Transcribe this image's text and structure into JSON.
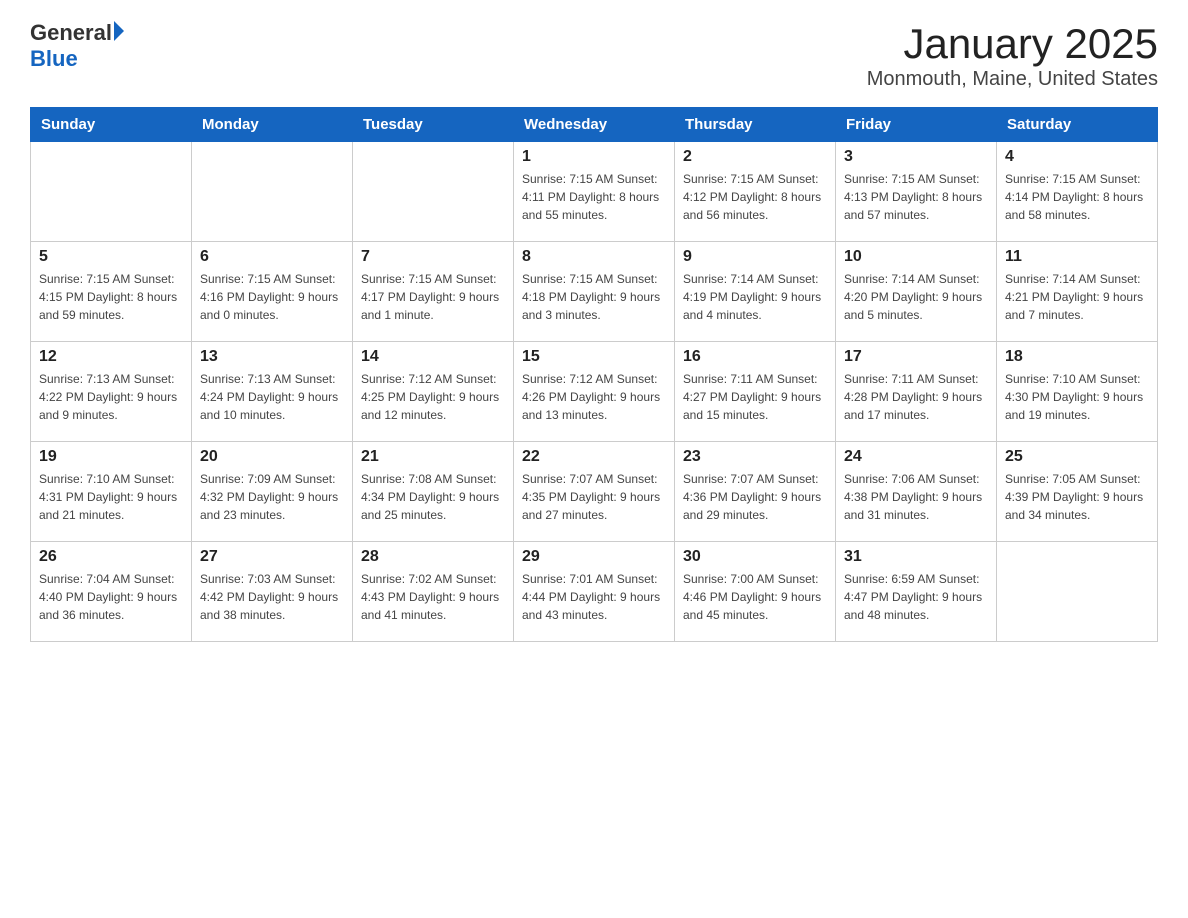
{
  "header": {
    "logo_general": "General",
    "logo_blue": "Blue",
    "title": "January 2025",
    "subtitle": "Monmouth, Maine, United States"
  },
  "days_of_week": [
    "Sunday",
    "Monday",
    "Tuesday",
    "Wednesday",
    "Thursday",
    "Friday",
    "Saturday"
  ],
  "weeks": [
    [
      {
        "day": "",
        "info": ""
      },
      {
        "day": "",
        "info": ""
      },
      {
        "day": "",
        "info": ""
      },
      {
        "day": "1",
        "info": "Sunrise: 7:15 AM\nSunset: 4:11 PM\nDaylight: 8 hours\nand 55 minutes."
      },
      {
        "day": "2",
        "info": "Sunrise: 7:15 AM\nSunset: 4:12 PM\nDaylight: 8 hours\nand 56 minutes."
      },
      {
        "day": "3",
        "info": "Sunrise: 7:15 AM\nSunset: 4:13 PM\nDaylight: 8 hours\nand 57 minutes."
      },
      {
        "day": "4",
        "info": "Sunrise: 7:15 AM\nSunset: 4:14 PM\nDaylight: 8 hours\nand 58 minutes."
      }
    ],
    [
      {
        "day": "5",
        "info": "Sunrise: 7:15 AM\nSunset: 4:15 PM\nDaylight: 8 hours\nand 59 minutes."
      },
      {
        "day": "6",
        "info": "Sunrise: 7:15 AM\nSunset: 4:16 PM\nDaylight: 9 hours\nand 0 minutes."
      },
      {
        "day": "7",
        "info": "Sunrise: 7:15 AM\nSunset: 4:17 PM\nDaylight: 9 hours\nand 1 minute."
      },
      {
        "day": "8",
        "info": "Sunrise: 7:15 AM\nSunset: 4:18 PM\nDaylight: 9 hours\nand 3 minutes."
      },
      {
        "day": "9",
        "info": "Sunrise: 7:14 AM\nSunset: 4:19 PM\nDaylight: 9 hours\nand 4 minutes."
      },
      {
        "day": "10",
        "info": "Sunrise: 7:14 AM\nSunset: 4:20 PM\nDaylight: 9 hours\nand 5 minutes."
      },
      {
        "day": "11",
        "info": "Sunrise: 7:14 AM\nSunset: 4:21 PM\nDaylight: 9 hours\nand 7 minutes."
      }
    ],
    [
      {
        "day": "12",
        "info": "Sunrise: 7:13 AM\nSunset: 4:22 PM\nDaylight: 9 hours\nand 9 minutes."
      },
      {
        "day": "13",
        "info": "Sunrise: 7:13 AM\nSunset: 4:24 PM\nDaylight: 9 hours\nand 10 minutes."
      },
      {
        "day": "14",
        "info": "Sunrise: 7:12 AM\nSunset: 4:25 PM\nDaylight: 9 hours\nand 12 minutes."
      },
      {
        "day": "15",
        "info": "Sunrise: 7:12 AM\nSunset: 4:26 PM\nDaylight: 9 hours\nand 13 minutes."
      },
      {
        "day": "16",
        "info": "Sunrise: 7:11 AM\nSunset: 4:27 PM\nDaylight: 9 hours\nand 15 minutes."
      },
      {
        "day": "17",
        "info": "Sunrise: 7:11 AM\nSunset: 4:28 PM\nDaylight: 9 hours\nand 17 minutes."
      },
      {
        "day": "18",
        "info": "Sunrise: 7:10 AM\nSunset: 4:30 PM\nDaylight: 9 hours\nand 19 minutes."
      }
    ],
    [
      {
        "day": "19",
        "info": "Sunrise: 7:10 AM\nSunset: 4:31 PM\nDaylight: 9 hours\nand 21 minutes."
      },
      {
        "day": "20",
        "info": "Sunrise: 7:09 AM\nSunset: 4:32 PM\nDaylight: 9 hours\nand 23 minutes."
      },
      {
        "day": "21",
        "info": "Sunrise: 7:08 AM\nSunset: 4:34 PM\nDaylight: 9 hours\nand 25 minutes."
      },
      {
        "day": "22",
        "info": "Sunrise: 7:07 AM\nSunset: 4:35 PM\nDaylight: 9 hours\nand 27 minutes."
      },
      {
        "day": "23",
        "info": "Sunrise: 7:07 AM\nSunset: 4:36 PM\nDaylight: 9 hours\nand 29 minutes."
      },
      {
        "day": "24",
        "info": "Sunrise: 7:06 AM\nSunset: 4:38 PM\nDaylight: 9 hours\nand 31 minutes."
      },
      {
        "day": "25",
        "info": "Sunrise: 7:05 AM\nSunset: 4:39 PM\nDaylight: 9 hours\nand 34 minutes."
      }
    ],
    [
      {
        "day": "26",
        "info": "Sunrise: 7:04 AM\nSunset: 4:40 PM\nDaylight: 9 hours\nand 36 minutes."
      },
      {
        "day": "27",
        "info": "Sunrise: 7:03 AM\nSunset: 4:42 PM\nDaylight: 9 hours\nand 38 minutes."
      },
      {
        "day": "28",
        "info": "Sunrise: 7:02 AM\nSunset: 4:43 PM\nDaylight: 9 hours\nand 41 minutes."
      },
      {
        "day": "29",
        "info": "Sunrise: 7:01 AM\nSunset: 4:44 PM\nDaylight: 9 hours\nand 43 minutes."
      },
      {
        "day": "30",
        "info": "Sunrise: 7:00 AM\nSunset: 4:46 PM\nDaylight: 9 hours\nand 45 minutes."
      },
      {
        "day": "31",
        "info": "Sunrise: 6:59 AM\nSunset: 4:47 PM\nDaylight: 9 hours\nand 48 minutes."
      },
      {
        "day": "",
        "info": ""
      }
    ]
  ]
}
